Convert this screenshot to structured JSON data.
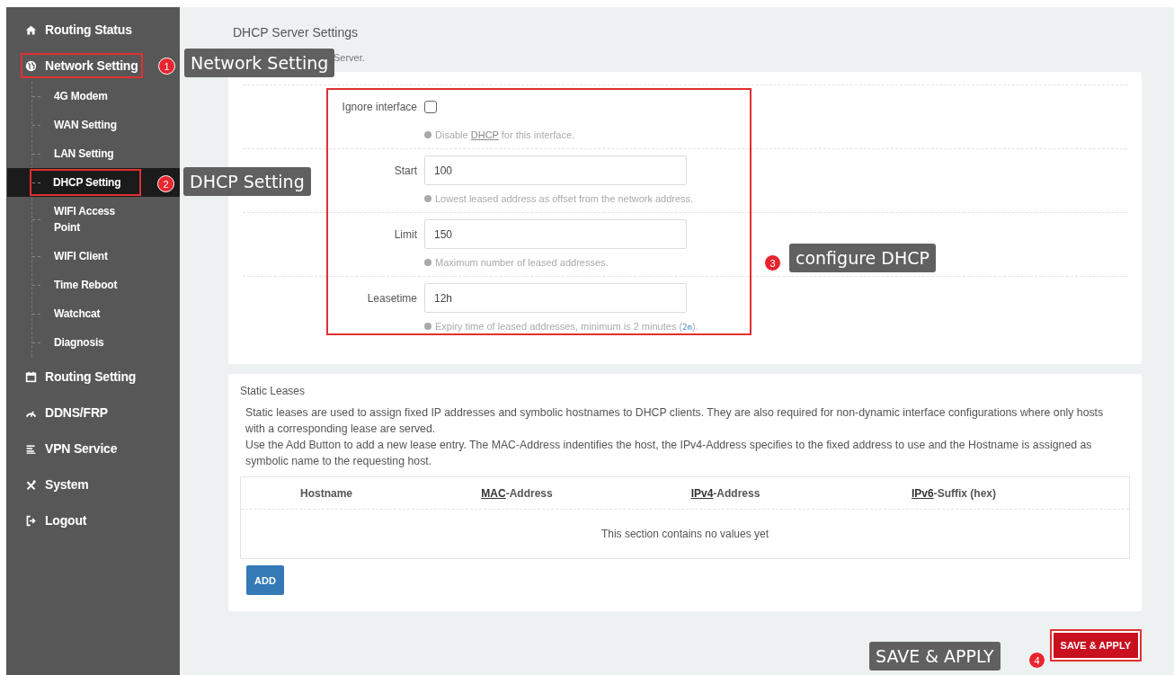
{
  "sidebar": {
    "items": [
      {
        "label": "Routing Status",
        "selected": false,
        "highlighted": false
      },
      {
        "label": "Network Setting",
        "selected": false,
        "highlighted": true,
        "children": [
          {
            "label": "4G Modem",
            "selected": false,
            "highlighted": false
          },
          {
            "label": "WAN Setting",
            "selected": false,
            "highlighted": false
          },
          {
            "label": "LAN Setting",
            "selected": false,
            "highlighted": false
          },
          {
            "label": "DHCP Setting",
            "selected": true,
            "highlighted": true
          },
          {
            "label": "WIFI Access Point",
            "selected": false,
            "highlighted": false
          },
          {
            "label": "WIFI Client",
            "selected": false,
            "highlighted": false
          },
          {
            "label": "Time Reboot",
            "selected": false,
            "highlighted": false
          },
          {
            "label": "Watchcat",
            "selected": false,
            "highlighted": false
          },
          {
            "label": "Diagnosis",
            "selected": false,
            "highlighted": false
          }
        ]
      },
      {
        "label": "Routing Setting",
        "selected": false,
        "highlighted": false
      },
      {
        "label": "DDNS/FRP",
        "selected": false,
        "highlighted": false
      },
      {
        "label": "VPN Service",
        "selected": false,
        "highlighted": false
      },
      {
        "label": "System",
        "selected": false,
        "highlighted": false
      },
      {
        "label": "Logout",
        "selected": false,
        "highlighted": false
      }
    ]
  },
  "page": {
    "title": "DHCP Server Settings",
    "subtitle": "Server."
  },
  "form": {
    "highlighted": true,
    "fields": [
      {
        "kind": "checkbox",
        "label": "Ignore interface",
        "checked": false,
        "help": [
          {
            "text": "Disable "
          },
          {
            "text": "DHCP",
            "kind": "abbr"
          },
          {
            "text": " for this interface."
          }
        ]
      },
      {
        "kind": "text",
        "label": "Start",
        "value": "100",
        "help": [
          {
            "text": "Lowest leased address as offset from the network address."
          }
        ]
      },
      {
        "kind": "text",
        "label": "Limit",
        "value": "150",
        "help": [
          {
            "text": "Maximum number of leased addresses."
          }
        ]
      },
      {
        "kind": "text",
        "label": "Leasetime",
        "value": "12h",
        "help": [
          {
            "text": "Expiry time of leased addresses, minimum is 2 minutes ("
          },
          {
            "text": "2m",
            "kind": "code"
          },
          {
            "text": ")."
          }
        ]
      }
    ]
  },
  "static_leases": {
    "title": "Static Leases",
    "description": [
      "Static leases are used to assign fixed IP addresses and symbolic hostnames to DHCP clients. They are also required for non-dynamic interface configurations where only hosts with a corresponding lease are served.",
      "Use the Add Button to add a new lease entry. The MAC-Address indentifies the host, the IPv4-Address specifies to the fixed address to use and the Hostname is assigned as symbolic name to the requesting host."
    ],
    "columns": [
      [
        {
          "text": "Hostname"
        }
      ],
      [
        {
          "text": "MAC",
          "kind": "abbr"
        },
        {
          "text": "-Address"
        }
      ],
      [
        {
          "text": "IPv4",
          "kind": "abbr"
        },
        {
          "text": "-Address"
        }
      ],
      [
        {
          "text": "IPv6",
          "kind": "abbr"
        },
        {
          "text": "-Suffix (hex)"
        }
      ]
    ],
    "empty_text": "This section contains no values yet",
    "add_button": "ADD"
  },
  "save_button": {
    "label": "SAVE & APPLY",
    "highlighted": true
  },
  "annotations": [
    {
      "number": "1",
      "label": "Network Setting"
    },
    {
      "number": "2",
      "label": "DHCP Setting"
    },
    {
      "number": "3",
      "label": "configure DHCP"
    },
    {
      "number": "4",
      "label": "SAVE & APPLY"
    }
  ]
}
